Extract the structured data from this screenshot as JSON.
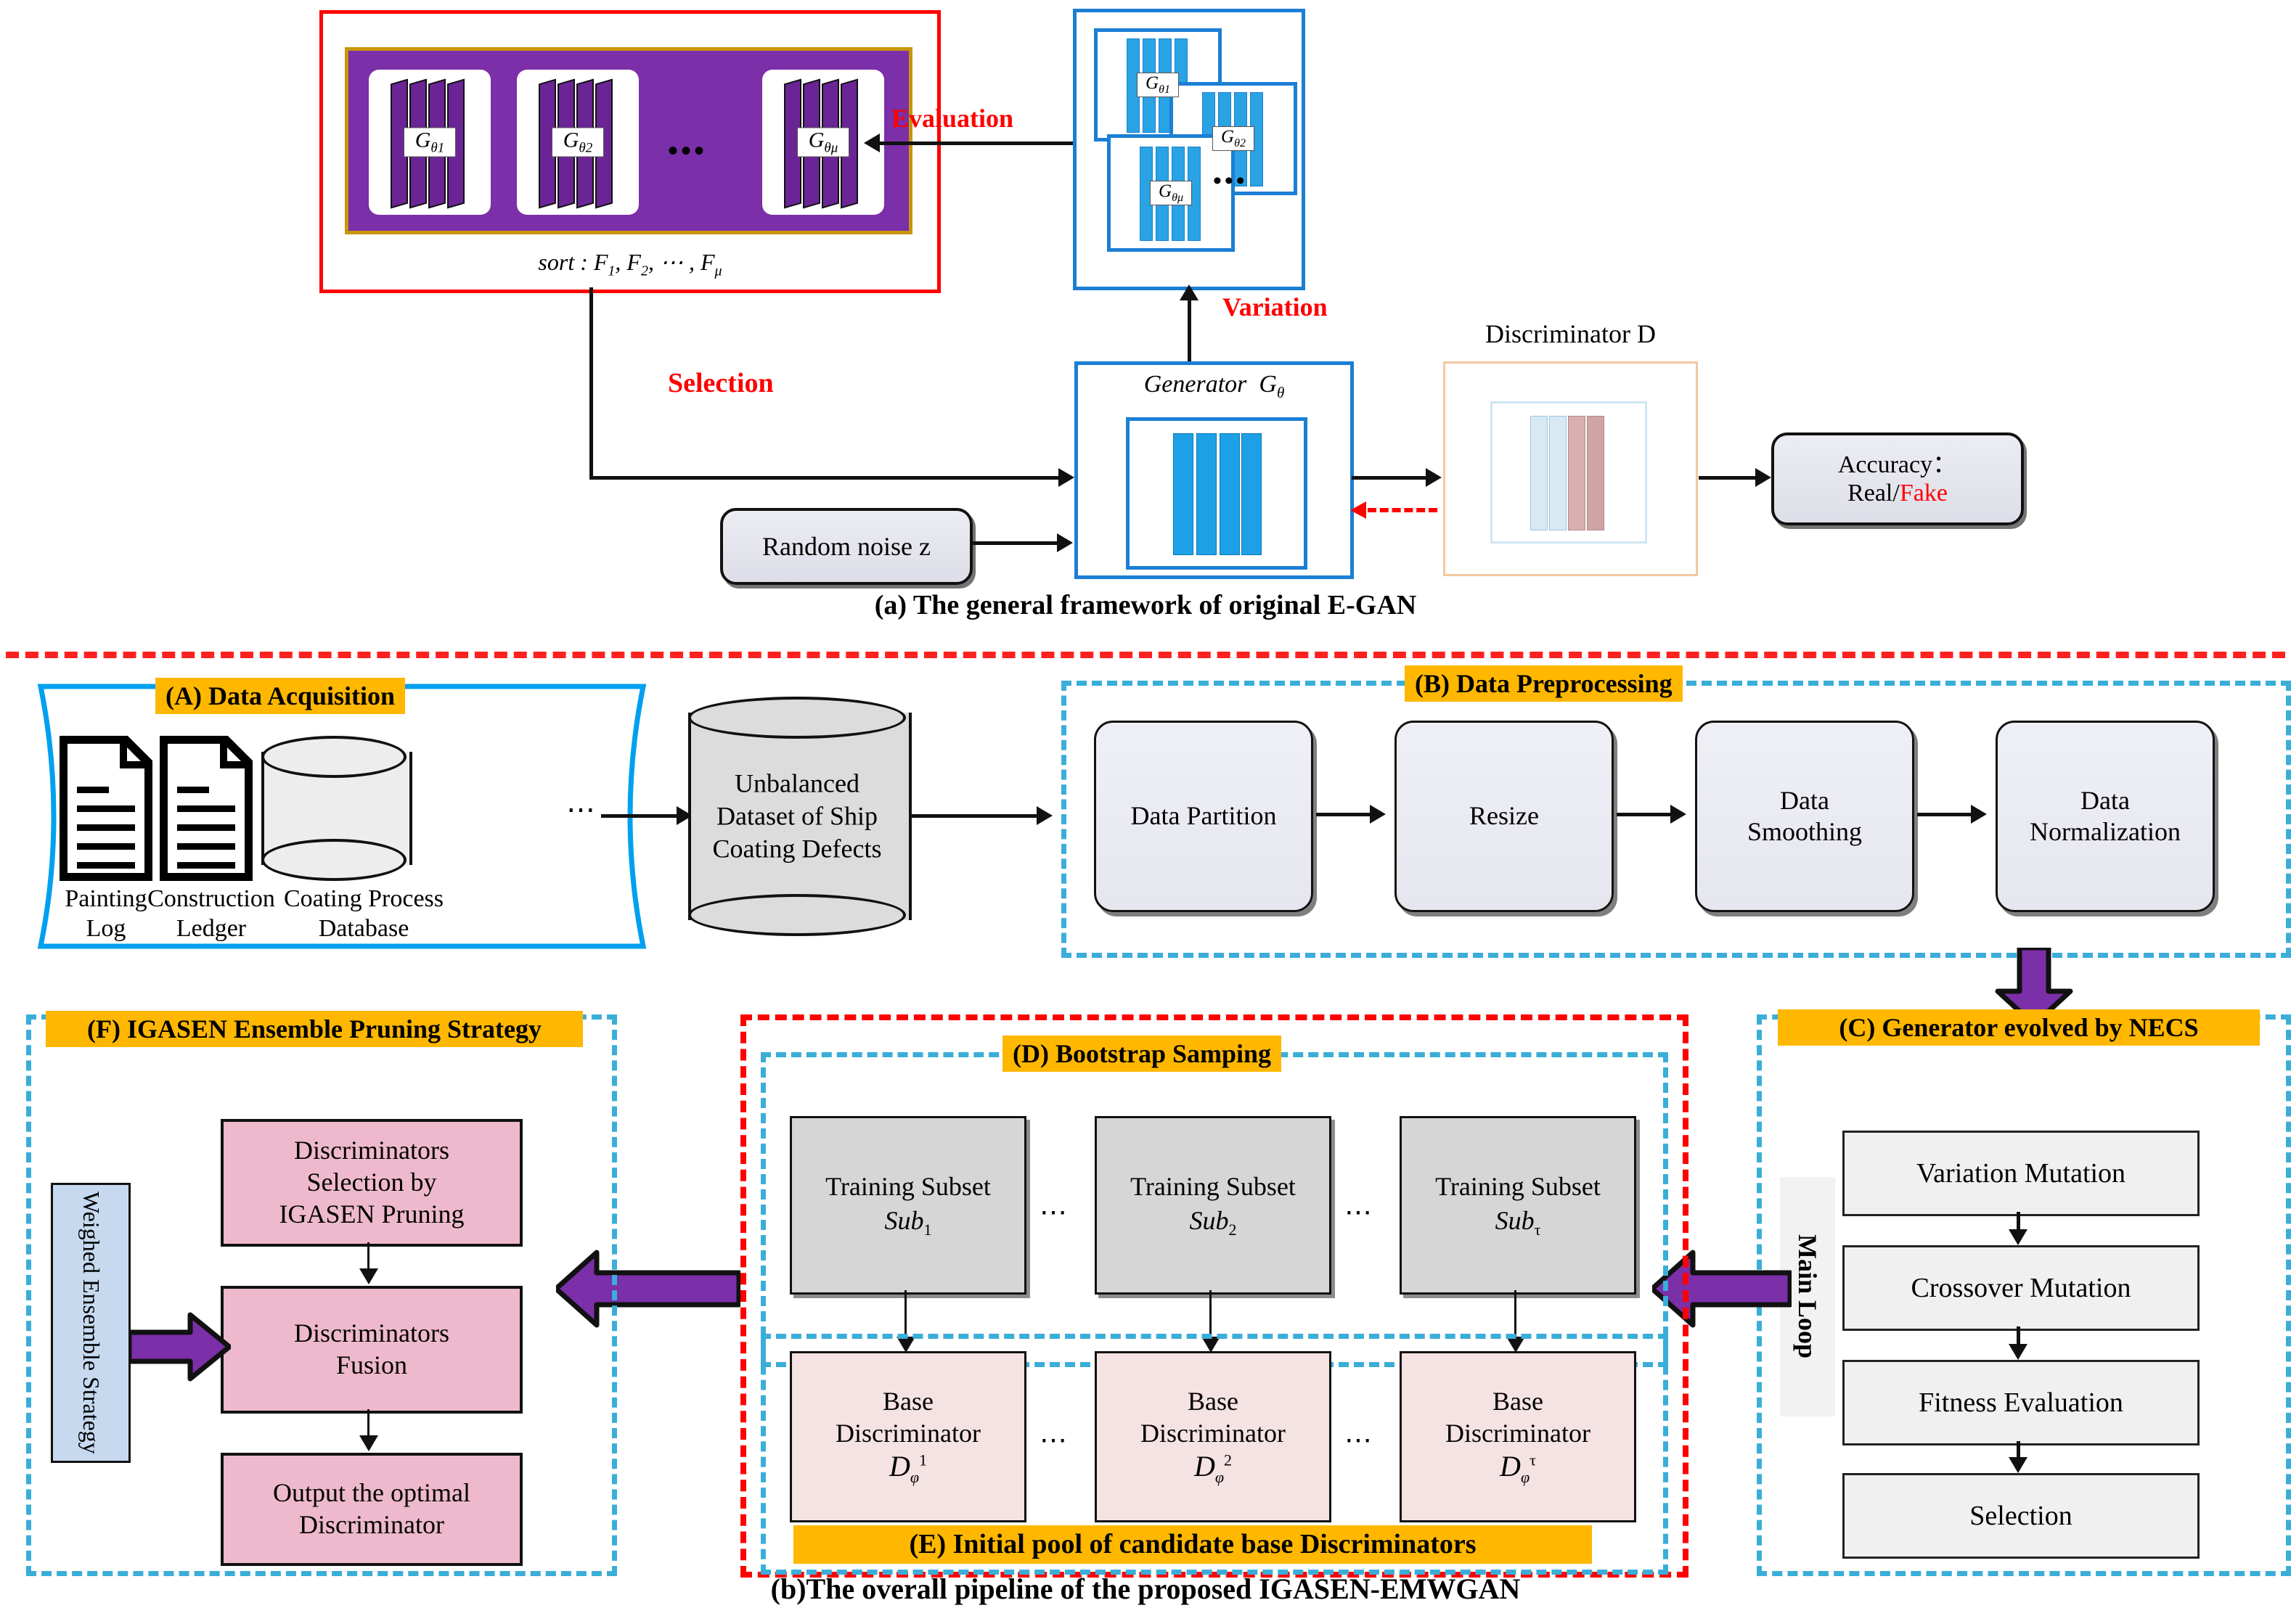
{
  "panel_a": {
    "caption": "(a) The general framework of original E-GAN",
    "population": {
      "generators": [
        {
          "symbol": "G",
          "sub": "θ1"
        },
        {
          "symbol": "G",
          "sub": "θ2"
        },
        {
          "symbol": "G",
          "sub": "θμ"
        }
      ],
      "ellipsis": "•••",
      "sort_text": "sort : F",
      "sort_full": "sort : F₁, F₂, ⋯ , Fμ"
    },
    "mutation": {
      "generators": [
        {
          "symbol": "G",
          "sub": "θ1"
        },
        {
          "symbol": "G",
          "sub": "θ2"
        },
        {
          "symbol": "G",
          "sub": "θμ"
        }
      ],
      "ellipsis": "•••"
    },
    "labels": {
      "evaluation": "Evaluation",
      "variation": "Variation",
      "selection": "Selection"
    },
    "generator": {
      "title": "Generator  G",
      "title_sub": "θ"
    },
    "discriminator": {
      "title": "Discriminator D"
    },
    "noise": {
      "label": "Random noise z"
    },
    "accuracy": {
      "line1": "Accuracy：",
      "real": "Real/",
      "fake": "Fake"
    }
  },
  "panel_b": {
    "caption": "(b)The overall pipeline of the proposed IGASEN-EMWGAN",
    "acquisition": {
      "title": "(A) Data Acquisition",
      "sources": [
        {
          "name": "Painting\nLog",
          "icon": "document-icon"
        },
        {
          "name": "Construction\nLedger",
          "icon": "document-icon"
        },
        {
          "name": "Coating Process\nDatabase",
          "icon": "database-icon"
        }
      ],
      "ellipsis": "⋯"
    },
    "dataset": {
      "label": "Unbalanced\nDataset of Ship\nCoating Defects"
    },
    "preprocessing": {
      "title": "(B) Data Preprocessing",
      "steps": [
        "Data Partition",
        "Resize",
        "Data\nSmoothing",
        "Data\nNormalization"
      ]
    },
    "necs": {
      "title": "(C) Generator evolved by NECS",
      "loop_label": "Main Loop",
      "steps": [
        "Variation Mutation",
        "Crossover Mutation",
        "Fitness Evaluation",
        "Selection"
      ]
    },
    "bootstrap": {
      "title": "(D) Bootstrap  Samping",
      "subsets": [
        {
          "line1": "Training Subset",
          "sym": "Sub",
          "sub": "1"
        },
        {
          "line1": "Training Subset",
          "sym": "Sub",
          "sub": "2"
        },
        {
          "line1": "Training Subset",
          "sym": "Sub",
          "sub": "τ"
        }
      ],
      "ellipsis": "⋯"
    },
    "pool": {
      "title": "(E) Initial pool of candidate base Discriminators",
      "discriminators": [
        {
          "line1": "Base",
          "line2": "Discriminator",
          "sym": "D",
          "sub": "ϕ",
          "sup": "1"
        },
        {
          "line1": "Base",
          "line2": "Discriminator",
          "sym": "D",
          "sub": "ϕ",
          "sup": "2"
        },
        {
          "line1": "Base",
          "line2": "Discriminator",
          "sym": "D",
          "sub": "ϕ",
          "sup": "τ"
        }
      ],
      "ellipsis": "⋯"
    },
    "pruning": {
      "title": "(F) IGASEN Ensemble Pruning Strategy",
      "weighted_label": "Weighed Ensemble Strategy",
      "steps": [
        "Discriminators\nSelection by\nIGASEN Pruning",
        "Discriminators\nFusion",
        "Output the optimal\nDiscriminator"
      ]
    }
  },
  "colors": {
    "red": "#ff0000",
    "gold": "#ffb700",
    "purple": "#7b2fa8",
    "blue": "#1b7fd4",
    "cyan_dash": "#3aaed8",
    "pink": "#eeb9cd",
    "light_blue_box": "#c6d9ef"
  }
}
